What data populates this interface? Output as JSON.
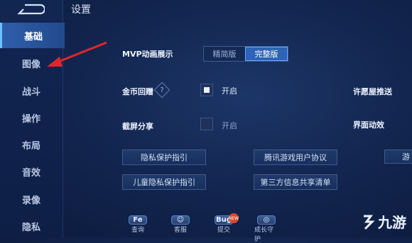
{
  "header": {
    "title": "设置"
  },
  "sidebar": {
    "items": [
      {
        "label": "基础",
        "active": true
      },
      {
        "label": "图像",
        "active": false
      },
      {
        "label": "战斗",
        "active": false
      },
      {
        "label": "操作",
        "active": false
      },
      {
        "label": "布局",
        "active": false
      },
      {
        "label": "音效",
        "active": false
      },
      {
        "label": "录像",
        "active": false
      },
      {
        "label": "隐私",
        "active": false
      }
    ]
  },
  "settings": {
    "mvp": {
      "label": "MVP动画展示",
      "options": [
        "精简版",
        "完整版"
      ],
      "selected": "完整版"
    },
    "coin_replay": {
      "label": "金币回赠",
      "checkbox_label": "开启",
      "checked": true,
      "help": "?"
    },
    "screenshot_share": {
      "label": "截屏分享",
      "checkbox_label": "开启",
      "checked": false
    },
    "wish_push": {
      "label": "许愿屋推送"
    },
    "ui_effects": {
      "label": "界面动效"
    }
  },
  "links": [
    "隐私保护指引",
    "腾讯游戏用户协议",
    "游",
    "儿童隐私保护指引",
    "第三方信息共享清单"
  ],
  "bottom": {
    "items": [
      {
        "label": "查询",
        "glyph": "Fe"
      },
      {
        "label": "客服",
        "glyph": "☺"
      },
      {
        "label": "提交",
        "glyph": "Bug"
      },
      {
        "label": "成长守护",
        "glyph": "◎"
      }
    ],
    "new_badge": "NEW"
  },
  "watermark": {
    "text": "九游"
  },
  "colors": {
    "accent": "#2d63b8",
    "annotation_arrow": "#e0262b"
  }
}
